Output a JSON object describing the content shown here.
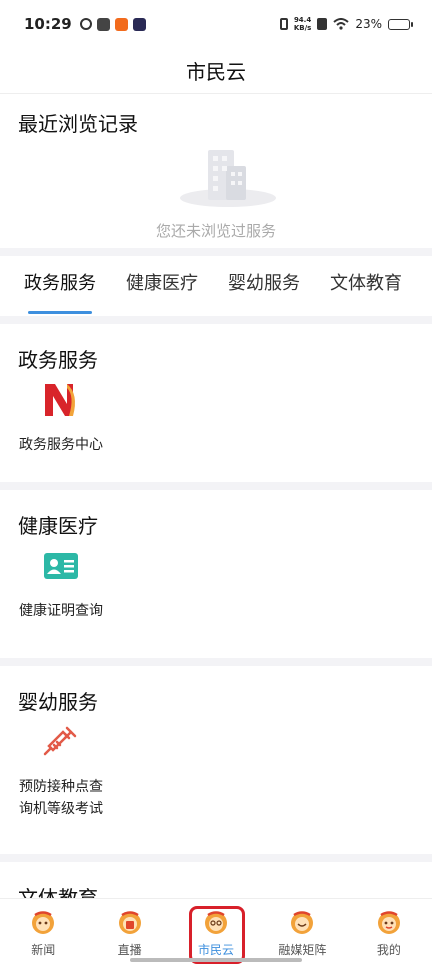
{
  "status_bar": {
    "time": "10:29",
    "net_speed_value": "94.4",
    "net_speed_unit": "KB/s",
    "battery": "23%",
    "battery_level": 0.23
  },
  "header": {
    "title": "市民云"
  },
  "recent": {
    "title": "最近浏览记录",
    "empty_text": "您还未浏览过服务"
  },
  "tabs": [
    {
      "label": "政务服务",
      "active": true
    },
    {
      "label": "健康医疗",
      "active": false
    },
    {
      "label": "婴幼服务",
      "active": false
    },
    {
      "label": "文体教育",
      "active": false
    }
  ],
  "sections": [
    {
      "title": "政务服务",
      "item_label": "政务服务中心",
      "icon": "gov-service-logo-icon"
    },
    {
      "title": "健康医疗",
      "item_label": "健康证明查询",
      "icon": "id-card-icon"
    },
    {
      "title": "婴幼服务",
      "item_label": "预防接种点查询机等级考试",
      "icon": "syringe-icon"
    },
    {
      "title": "文体教育"
    }
  ],
  "bottom_nav": [
    {
      "label": "新闻",
      "active": false
    },
    {
      "label": "直播",
      "active": false
    },
    {
      "label": "市民云",
      "active": true
    },
    {
      "label": "融媒矩阵",
      "active": false
    },
    {
      "label": "我的",
      "active": false
    }
  ],
  "colors": {
    "accent": "#3d8fde",
    "highlight_border": "#d8202a",
    "health_icon": "#2cb8a6",
    "syringe_icon": "#e25a48",
    "gov_logo_red": "#d8242a",
    "gov_logo_orange": "#f2a43a"
  }
}
